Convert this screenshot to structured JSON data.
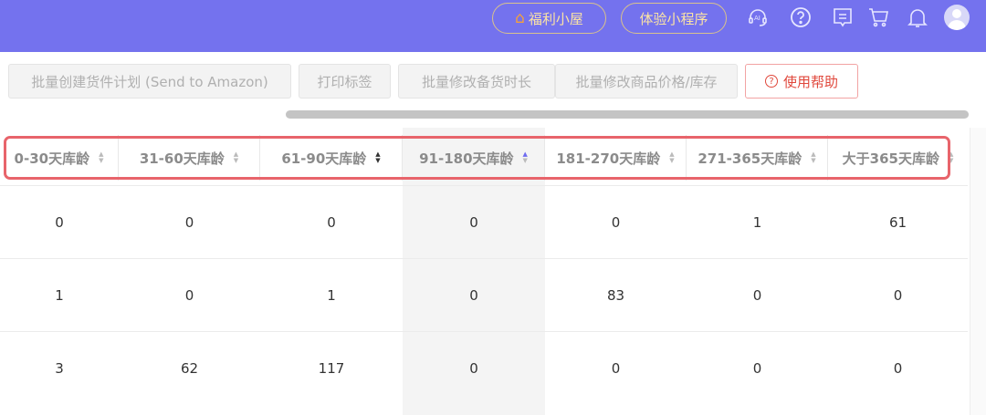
{
  "topbar": {
    "welfare_label": "福利小屋",
    "miniprogram_label": "体验小程序",
    "icons": [
      "ai-support-icon",
      "help-icon",
      "message-icon",
      "cart-icon",
      "bell-icon",
      "avatar"
    ]
  },
  "toolbar": {
    "buttons": [
      "批量创建货件计划 (Send to Amazon)",
      "打印标签",
      "批量修改备货时长",
      "批量修改商品价格/库存"
    ],
    "help_label": "使用帮助"
  },
  "table": {
    "columns": [
      "0-30天库龄",
      "31-60天库龄",
      "61-90天库龄",
      "91-180天库龄",
      "181-270天库龄",
      "271-365天库龄",
      "大于365天库龄"
    ],
    "sorted_column": "91-180天库龄",
    "rows": [
      [
        "0",
        "0",
        "0",
        "0",
        "0",
        "1",
        "61"
      ],
      [
        "1",
        "0",
        "1",
        "0",
        "83",
        "0",
        "0"
      ],
      [
        "3",
        "62",
        "117",
        "0",
        "0",
        "0",
        "0"
      ]
    ]
  },
  "colors": {
    "topbar": "#7472ee",
    "highlight": "#e8646b"
  }
}
